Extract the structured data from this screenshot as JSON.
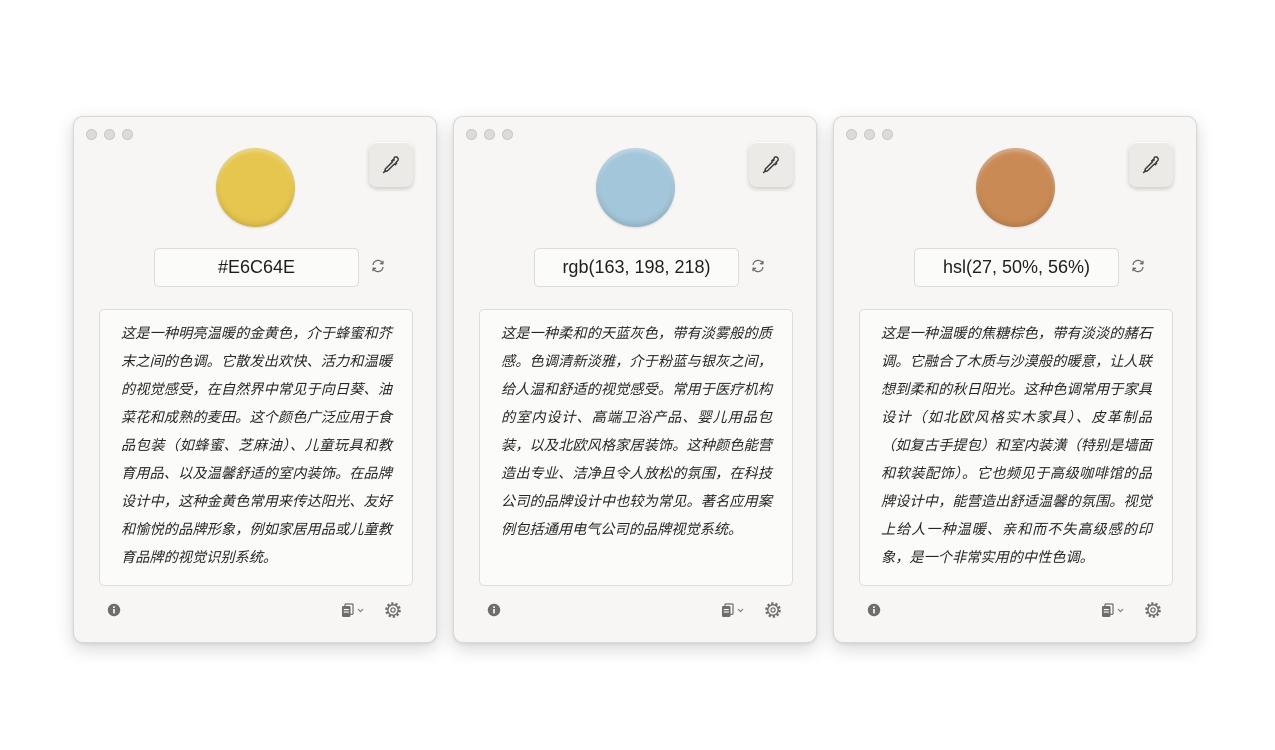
{
  "windows": [
    {
      "swatch_color": "#E6C64E",
      "value": "#E6C64E",
      "description": "这是一种明亮温暖的金黄色，介于蜂蜜和芥末之间的色调。它散发出欢快、活力和温暖的视觉感受，在自然界中常见于向日葵、油菜花和成熟的麦田。这个颜色广泛应用于食品包装（如蜂蜜、芝麻油）、儿童玩具和教育用品、以及温馨舒适的室内装饰。在品牌设计中，这种金黄色常用来传达阳光、友好和愉悦的品牌形象，例如家居用品或儿童教育品牌的视觉识别系统。"
    },
    {
      "swatch_color": "#A3C6DA",
      "value": "rgb(163, 198, 218)",
      "description": "这是一种柔和的天蓝灰色，带有淡雾般的质感。色调清新淡雅，介于粉蓝与银灰之间，给人温和舒适的视觉感受。常用于医疗机构的室内设计、高端卫浴产品、婴儿用品包装，以及北欧风格家居装饰。这种颜色能营造出专业、洁净且令人放松的氛围，在科技公司的品牌设计中也较为常见。著名应用案例包括通用电气公司的品牌视觉系统。"
    },
    {
      "swatch_color": "#C98A55",
      "value": "hsl(27, 50%, 56%)",
      "description": "这是一种温暖的焦糖棕色，带有淡淡的赭石调。它融合了木质与沙漠般的暖意，让人联想到柔和的秋日阳光。这种色调常用于家具设计（如北欧风格实木家具）、皮革制品（如复古手提包）和室内装潢（特别是墙面和软装配饰）。它也频见于高级咖啡馆的品牌设计中，能营造出舒适温馨的氛围。视觉上给人一种温暖、亲和而不失高级感的印象，是一个非常实用的中性色调。"
    }
  ],
  "icons": {
    "picker": "eyedropper-icon",
    "refresh": "refresh-icon",
    "info": "info-icon",
    "copy": "copy-icon",
    "menu_chevron": "chevron-down-icon",
    "settings": "gear-icon"
  }
}
